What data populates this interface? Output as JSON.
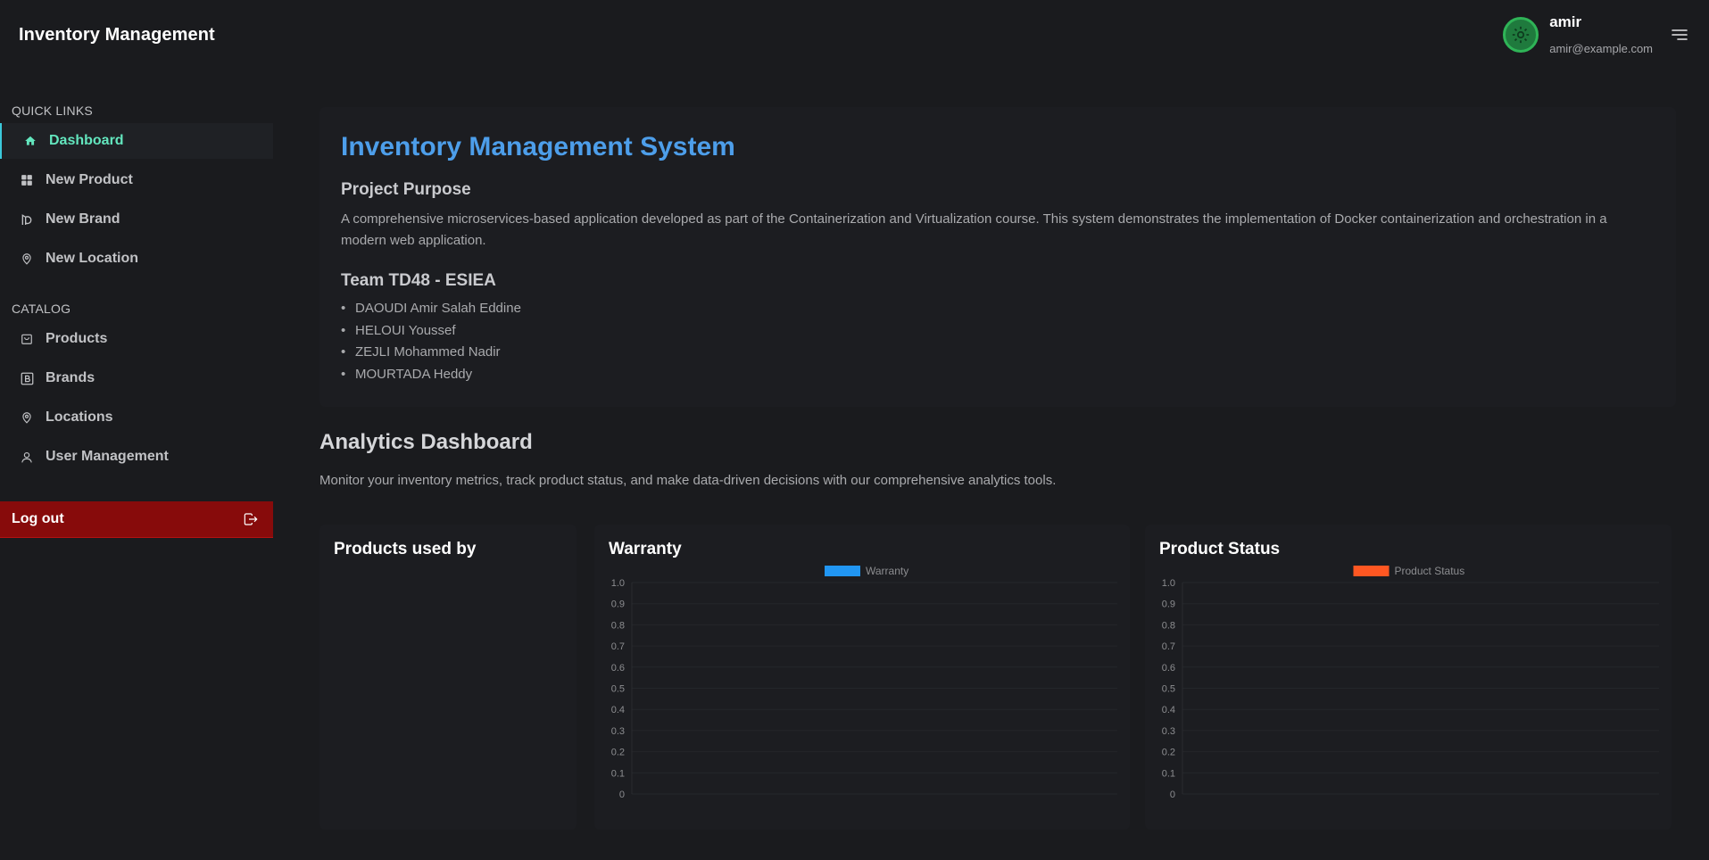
{
  "header": {
    "app_title": "Inventory Management",
    "user_name": "amir",
    "user_email": "amir@example.com"
  },
  "sidebar": {
    "quick_links_label": "QUICK LINKS",
    "quick_links": [
      {
        "label": "Dashboard",
        "icon": "home-icon",
        "active": true
      },
      {
        "label": "New Product",
        "icon": "grid-icon"
      },
      {
        "label": "New Brand",
        "icon": "brand-icon"
      },
      {
        "label": "New Location",
        "icon": "map-pin-icon"
      }
    ],
    "catalog_label": "CATALOG",
    "catalog": [
      {
        "label": "Products",
        "icon": "bag-icon"
      },
      {
        "label": "Brands",
        "icon": "b-box-icon"
      },
      {
        "label": "Locations",
        "icon": "map-pin-icon"
      },
      {
        "label": "User Management",
        "icon": "user-icon"
      }
    ],
    "logout_label": "Log out"
  },
  "intro": {
    "title": "Inventory Management System",
    "purpose_heading": "Project Purpose",
    "purpose_text": "A comprehensive microservices-based application developed as part of the Containerization and Virtualization course. This system demonstrates the implementation of Docker containerization and orchestration in a modern web application.",
    "team_heading": "Team TD48 - ESIEA",
    "team_members": [
      "DAOUDI Amir Salah Eddine",
      "HELOUI Youssef",
      "ZEJLI Mohammed Nadir",
      "MOURTADA Heddy"
    ]
  },
  "analytics": {
    "title": "Analytics Dashboard",
    "description": "Monitor your inventory metrics, track product status, and make data-driven decisions with our comprehensive analytics tools."
  },
  "charts": {
    "products_used_by_title": "Products used by",
    "warranty_title": "Warranty",
    "product_status_title": "Product Status"
  },
  "colors": {
    "accent_blue": "#4d9eea",
    "active_teal": "#63e6be",
    "logout_red": "#870b0b",
    "warranty_series": "#2196f3",
    "status_series": "#ff5722"
  },
  "chart_data": [
    {
      "type": "bar",
      "title": "Warranty",
      "series": [
        {
          "name": "Warranty",
          "values": []
        }
      ],
      "categories": [],
      "yticks": [
        "1.0",
        "0.9",
        "0.8",
        "0.7",
        "0.6",
        "0.5",
        "0.4",
        "0.3",
        "0.2",
        "0.1",
        "0"
      ],
      "ylim": [
        0,
        1
      ],
      "legend": "top-center",
      "grid": true
    },
    {
      "type": "bar",
      "title": "Product Status",
      "series": [
        {
          "name": "Product Status",
          "values": []
        }
      ],
      "categories": [],
      "yticks": [
        "1.0",
        "0.9",
        "0.8",
        "0.7",
        "0.6",
        "0.5",
        "0.4",
        "0.3",
        "0.2",
        "0.1",
        "0"
      ],
      "ylim": [
        0,
        1
      ],
      "legend": "top-center",
      "grid": true
    }
  ]
}
